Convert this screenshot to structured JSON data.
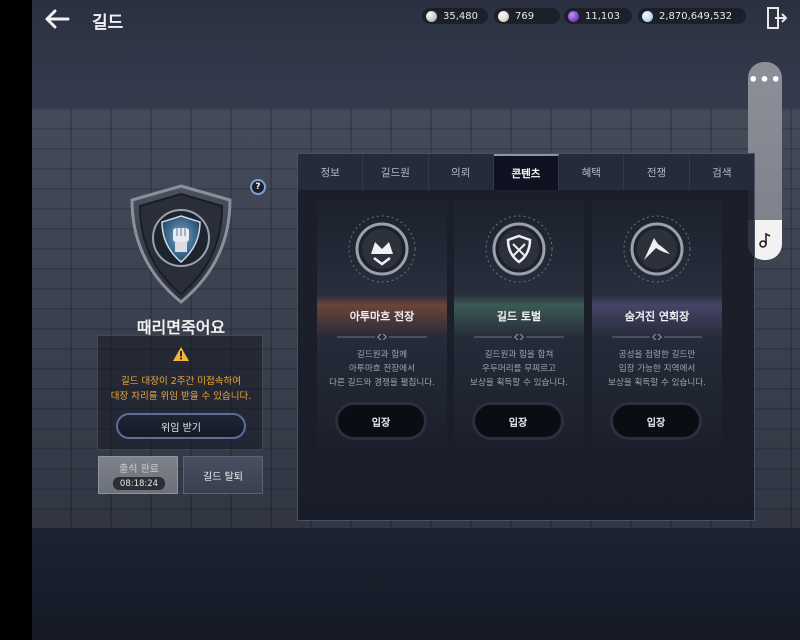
{
  "header": {
    "title": "길드",
    "currencies": [
      {
        "icon": "silver-coin-icon",
        "value": "35,480",
        "color": "#c9c9c9"
      },
      {
        "icon": "pearl-icon",
        "value": "769",
        "color": "#e8e0d8"
      },
      {
        "icon": "purple-gem-icon",
        "value": "11,103",
        "color": "#7a38d0"
      },
      {
        "icon": "crystal-icon",
        "value": "2,870,649,532",
        "color": "#cfe4f6"
      }
    ]
  },
  "guild": {
    "name": "때리면죽어요",
    "notice_line1": "길드 대장이 2주간 미접속하여",
    "notice_line2": "대장 자리를 위임 받을 수 있습니다.",
    "delegate_label": "위임 받기",
    "attendance_label": "출석 완료",
    "attendance_timer": "08:18:24",
    "leave_label": "길드 탈퇴"
  },
  "tabs": [
    {
      "label": "정보"
    },
    {
      "label": "길드원"
    },
    {
      "label": "의뢰"
    },
    {
      "label": "콘텐츠"
    },
    {
      "label": "혜택"
    },
    {
      "label": "전쟁"
    },
    {
      "label": "검색"
    }
  ],
  "active_tab": "콘텐츠",
  "contents": [
    {
      "title": "아투마흐 전장",
      "desc1": "길드원과 함께",
      "desc2": "아투마흐 전장에서",
      "desc3": "다른 길드와 경쟁을 펼칩니다.",
      "button": "입장",
      "accent": "#7a4a3e"
    },
    {
      "title": "길드 토벌",
      "desc1": "길드원과 힘을 합쳐",
      "desc2": "우두머리를 무찌르고",
      "desc3": "보상을 획득할 수 있습니다.",
      "button": "입장",
      "accent": "#3c5f5a"
    },
    {
      "title": "숨겨진 연회장",
      "desc1": "공성을 점령한 길드만",
      "desc2": "입장 가능한 지역에서",
      "desc3": "보상을 획득할 수 있습니다.",
      "button": "입장",
      "accent": "#4a4a6e"
    }
  ],
  "side_panel": {
    "menu": "•••"
  }
}
